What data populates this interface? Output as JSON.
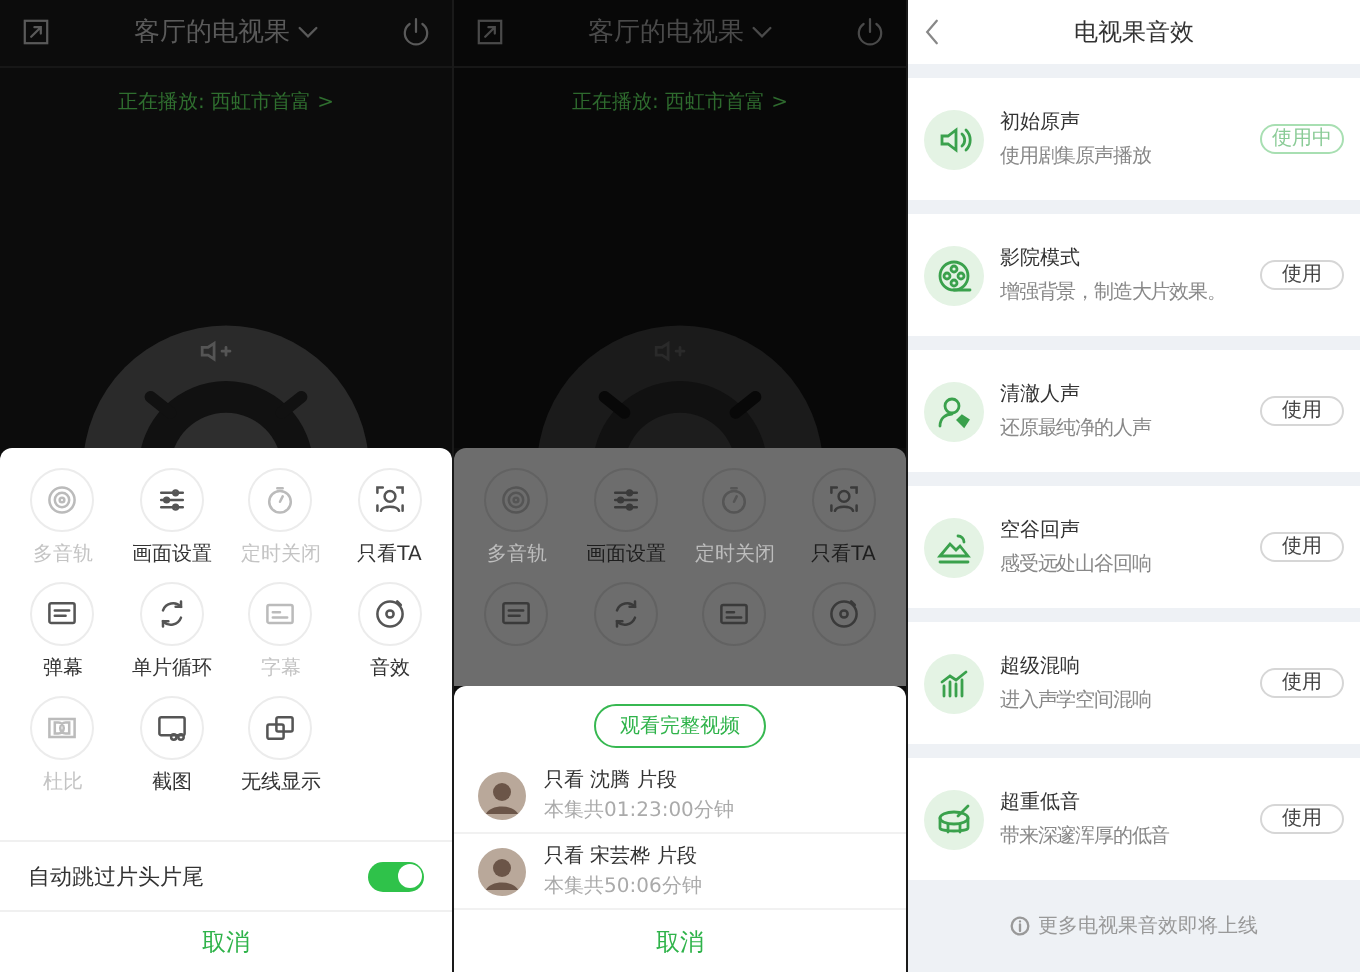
{
  "remote_screen": {
    "title": "客厅的电视果",
    "now_playing": "正在播放: 西虹市首富 >",
    "menu": [
      {
        "label": "多音轨",
        "disabled": true
      },
      {
        "label": "画面设置",
        "disabled": false
      },
      {
        "label": "定时关闭",
        "disabled": true
      },
      {
        "label": "只看TA",
        "disabled": false
      },
      {
        "label": "弹幕",
        "disabled": false
      },
      {
        "label": "单片循环",
        "disabled": false
      },
      {
        "label": "字幕",
        "disabled": true
      },
      {
        "label": "音效",
        "disabled": false
      },
      {
        "label": "杜比",
        "disabled": true
      },
      {
        "label": "截图",
        "disabled": false
      },
      {
        "label": "无线显示",
        "disabled": false
      }
    ],
    "toggle": {
      "label": "自动跳过片头片尾",
      "on": true
    },
    "cancel": "取消"
  },
  "clip_screen": {
    "title": "客厅的电视果",
    "now_playing": "正在播放: 西虹市首富 >",
    "menu": [
      {
        "label": "多音轨",
        "disabled": true
      },
      {
        "label": "画面设置",
        "disabled": false
      },
      {
        "label": "定时关闭",
        "disabled": true
      },
      {
        "label": "只看TA",
        "disabled": false
      }
    ],
    "watch_full": "观看完整视频",
    "clips": [
      {
        "title": "只看 沈腾 片段",
        "meta": "本集共01:23:00分钟"
      },
      {
        "title": "只看 宋芸桦 片段",
        "meta": "本集共50:06分钟"
      }
    ],
    "cancel": "取消"
  },
  "sound_screen": {
    "title": "电视果音效",
    "effects": [
      {
        "name": "初始原声",
        "desc": "使用剧集原声播放",
        "button": "使用中",
        "in_use": true
      },
      {
        "name": "影院模式",
        "desc": "增强背景，制造大片效果。",
        "button": "使用",
        "in_use": false
      },
      {
        "name": "清澈人声",
        "desc": "还原最纯净的人声",
        "button": "使用",
        "in_use": false
      },
      {
        "name": "空谷回声",
        "desc": "感受远处山谷回响",
        "button": "使用",
        "in_use": false
      },
      {
        "name": "超级混响",
        "desc": "进入声学空间混响",
        "button": "使用",
        "in_use": false
      },
      {
        "name": "超重低音",
        "desc": "带来深邃浑厚的低音",
        "button": "使用",
        "in_use": false
      }
    ],
    "note": "更多电视果音效即将上线"
  }
}
